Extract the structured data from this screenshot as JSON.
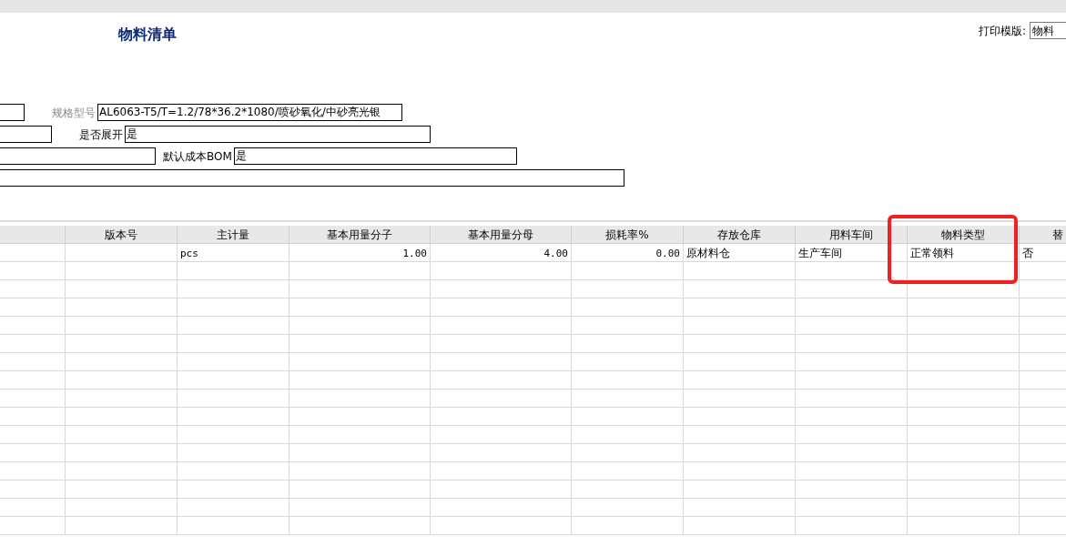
{
  "title": "物料清单",
  "print_template": {
    "label": "打印模版:",
    "value": "物料"
  },
  "form": [
    {
      "label": "规格型号",
      "muted": true,
      "value": "AL6063-T5/T=1.2/78*36.2*1080/喷砂氧化/中砂亮光银"
    },
    {
      "label": "是否展开",
      "muted": false,
      "value": "是"
    },
    {
      "label": "默认成本BOM",
      "muted": false,
      "value": "是"
    }
  ],
  "table": {
    "columns": [
      "版本号",
      "主计量",
      "基本用量分子",
      "基本用量分母",
      "损耗率%",
      "存放仓库",
      "用料车间",
      "物料类型",
      "替"
    ],
    "rows": [
      {
        "cells": [
          null,
          "pcs",
          "1.00",
          "4.00",
          "0.00",
          "原材料仓",
          "生产车间",
          "正常领料",
          "否"
        ]
      }
    ]
  },
  "annotations": [
    {
      "kind": "frame"
    }
  ]
}
